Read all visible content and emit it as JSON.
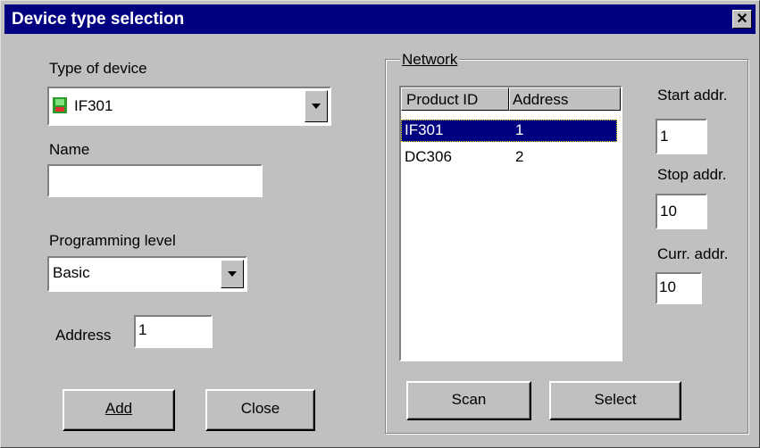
{
  "window": {
    "title": "Device type selection"
  },
  "left": {
    "type_of_device_label": "Type of device",
    "type_of_device_value": "IF301",
    "name_label": "Name",
    "name_value": "",
    "programming_level_label": "Programming level",
    "programming_level_value": "Basic",
    "address_label": "Address",
    "address_value": "1"
  },
  "buttons": {
    "add": "Add",
    "close": "Close",
    "scan": "Scan",
    "select": "Select"
  },
  "network": {
    "title": "Network",
    "columns": [
      "Product ID",
      "Address"
    ],
    "rows": [
      {
        "product_id": "IF301",
        "address": "1"
      },
      {
        "product_id": "DC306",
        "address": "2"
      }
    ],
    "start_label": "Start addr.",
    "start_value": "1",
    "stop_label": "Stop addr.",
    "stop_value": "10",
    "curr_label": "Curr. addr.",
    "curr_value": "10"
  },
  "icons": {
    "close": "close-icon",
    "device": "device-icon",
    "dropdown": "chevron-down-icon"
  },
  "colors": {
    "titlebar": "#000080",
    "face": "#c0c0c0",
    "selection": "#000080"
  }
}
